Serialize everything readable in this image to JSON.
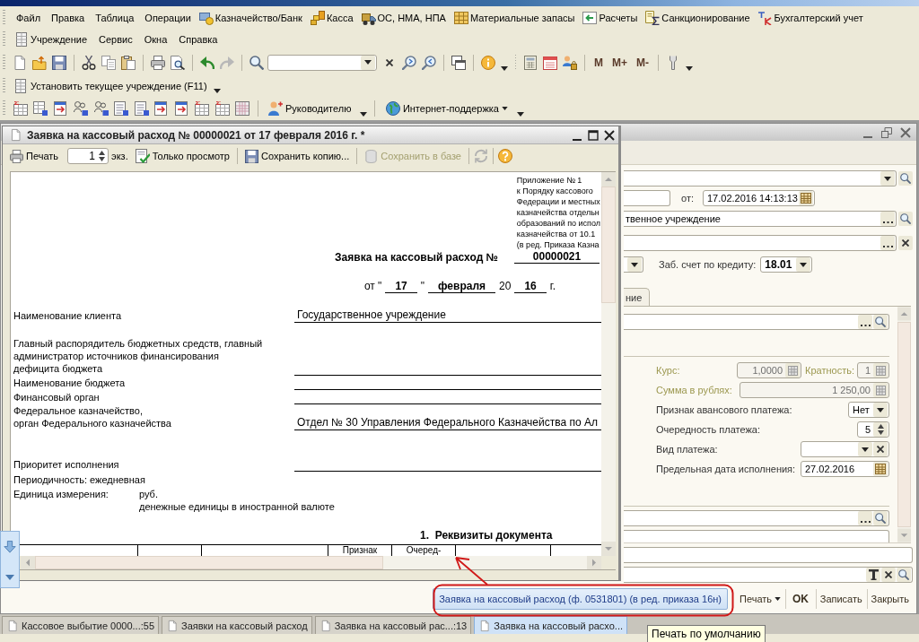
{
  "menu_bar": {
    "row_1": [
      {
        "label": "Файл",
        "icon": false
      },
      {
        "label": "Правка",
        "icon": false
      },
      {
        "label": "Таблица",
        "icon": false
      },
      {
        "label": "Операции",
        "icon": false
      },
      {
        "label": "Казначейство/Банк",
        "icon": true
      },
      {
        "label": "Касса",
        "icon": true
      },
      {
        "label": "ОС, НМА, НПА",
        "icon": true
      },
      {
        "label": "Материальные запасы",
        "icon": true
      },
      {
        "label": "Расчеты",
        "icon": true
      },
      {
        "label": "Санкционирование",
        "icon": true
      },
      {
        "label": "Бухгалтерский учет",
        "icon": true
      }
    ],
    "row_2": [
      {
        "label": "Учреждение",
        "icon": true
      },
      {
        "label": "Сервис",
        "icon": false
      },
      {
        "label": "Окна",
        "icon": false
      },
      {
        "label": "Справка",
        "icon": false
      }
    ]
  },
  "standard_toolbar": {
    "memory_buttons": [
      "M",
      "M+",
      "M-"
    ]
  },
  "institution_toolbar": {
    "button": "Установить текущее учреждение (F11)"
  },
  "reports_toolbar": {
    "buttons": [
      {
        "label": "Руководителю",
        "menu": false
      },
      {
        "label": "Интернет-поддержка",
        "menu": true
      }
    ]
  },
  "preview_window": {
    "title": "Заявка на кассовый расход № 00000021 от 17 февраля 2016 г. *",
    "toolbar": {
      "print": "Печать",
      "copies": "1",
      "copies_unit": "экз.",
      "read_only": "Только просмотр",
      "save_copy": "Сохранить копию...",
      "save_to_base": {
        "label": "Сохранить в базе",
        "disabled": true
      },
      "refresh": {
        "disabled": true
      }
    },
    "document": {
      "appendix": "Приложение № 1\nк Порядку кассового\nФедерации и местных\nказначейства отдельн\nобразований по испол\nказначейства от 10.1\n(в ред. Приказа Казна",
      "heading": "Заявка на кассовый расход №",
      "number": "00000021",
      "date": [
        {
          "text": "от \"",
          "underlined": false
        },
        {
          "text": "17",
          "underlined": true
        },
        {
          "text": "\"",
          "underlined": false
        },
        {
          "text": "февраля",
          "underlined": true
        },
        {
          "text": "20",
          "underlined": false
        },
        {
          "text": "16",
          "underlined": true
        },
        {
          "text": "г.",
          "underlined": false
        }
      ],
      "fields": [
        {
          "label": "Наименование клиента",
          "value": "Государственное учреждение"
        },
        {
          "label": "Главный распорядитель бюджетных средств, главный\nадминистратор источников финансирования\nдефицита бюджета"
        },
        {
          "label": "Наименование бюджета"
        },
        {
          "label": "Финансовый орган"
        },
        {
          "label": "Федеральное казначейство,\nорган Федерального казначейства",
          "value": "Отдел № 30 Управления Федерального Казначейства по Ал"
        },
        {
          "label": "Приоритет исполнения"
        }
      ],
      "periodicity": "Периодичность: ежедневная",
      "unit": {
        "label": "Единица измерения:",
        "values": [
          "руб.",
          "денежные единицы в иностранной валюте"
        ]
      },
      "section_title": "1.  Реквизиты документа",
      "table_columns": [
        {},
        {},
        {},
        {
          "label": "Признак"
        },
        {
          "label": "Очеред-"
        },
        {},
        {}
      ]
    }
  },
  "document_form": {
    "number_row": {
      "date_label": "от:",
      "date": "17.02.2016 14:13:13"
    },
    "organization": "твенное учреждение",
    "credit_account": {
      "label": "Заб. счет по кредиту:",
      "value": "18.01"
    },
    "tabs": [
      {
        "label": "ние",
        "selected": true
      }
    ],
    "rate": {
      "label": "Курс:",
      "value": "1,0000",
      "disabled": true
    },
    "multiplicity": {
      "label": "Кратность:",
      "value": "1",
      "disabled": true
    },
    "amount_rub": {
      "label": "Сумма в рублях:",
      "value": "1 250,00",
      "disabled": true
    },
    "advance_payment": {
      "label": "Признак авансового платежа:",
      "value": "Нет",
      "disabled": false
    },
    "payment_priority": {
      "label": "Очередность платежа:",
      "value": "5",
      "disabled": false
    },
    "payment_type": {
      "label": "Вид платежа:",
      "disabled": false
    },
    "deadline": {
      "label": "Предельная дата исполнения:",
      "value": "27.02.2016",
      "disabled": false
    },
    "command_bar": {
      "default_print": {
        "label": "Заявка на кассовый расход (ф. 0531801) (в ред. приказа 16н)",
        "focused": true
      },
      "buttons": [
        {
          "label": "Печать",
          "menu": true,
          "default": false
        },
        {
          "label": "OK",
          "menu": false,
          "default": true
        },
        {
          "label": "Записать",
          "menu": false,
          "default": false
        },
        {
          "label": "Закрыть",
          "menu": false,
          "default": false
        }
      ]
    }
  },
  "window_tabs": [
    {
      "label": "Кассовое выбытие 0000...:55",
      "selected": false
    },
    {
      "label": "Заявки на кассовый расход",
      "selected": false
    },
    {
      "label": "Заявка на кассовый рас...:13",
      "selected": false
    },
    {
      "label": "Заявка на кассовый расхо...",
      "selected": true
    }
  ],
  "tooltip": "Печать по умолчанию"
}
